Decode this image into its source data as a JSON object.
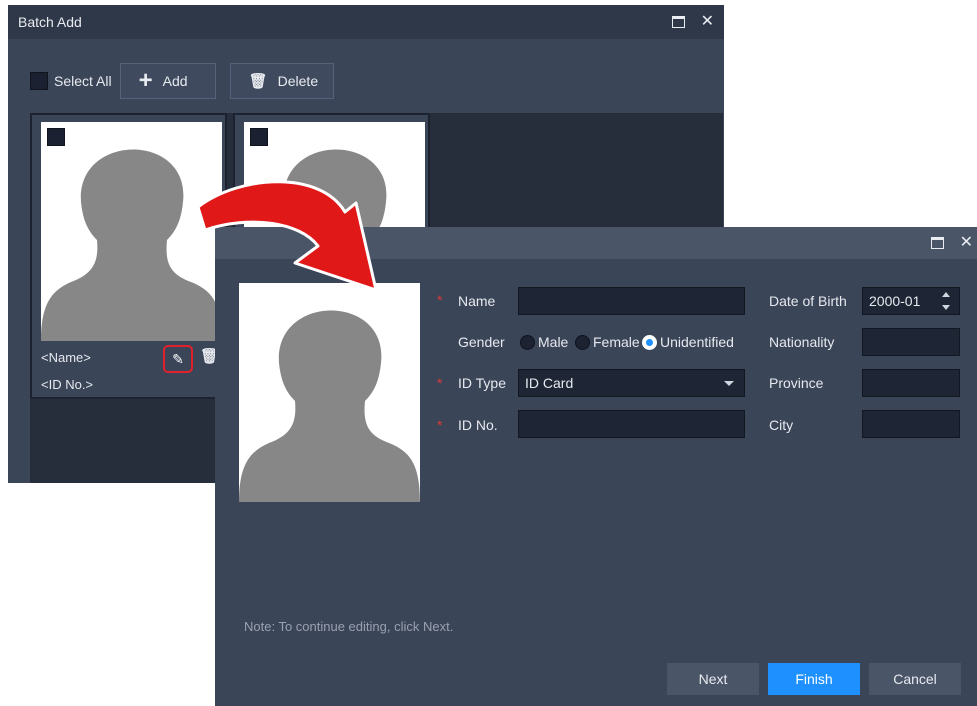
{
  "batch_window": {
    "title": "Batch Add",
    "select_all": "Select All",
    "add_label": "Add",
    "delete_label": "Delete",
    "cards": [
      {
        "name": "<Name>",
        "id_no": "<ID No.>"
      },
      {
        "name": "",
        "id_no": ""
      }
    ]
  },
  "edit_dialog": {
    "fields": {
      "name_label": "Name",
      "name_value": "",
      "gender_label": "Gender",
      "gender_options": [
        "Male",
        "Female",
        "Unidentified"
      ],
      "gender_selected": "Unidentified",
      "id_type_label": "ID Type",
      "id_type_value": "ID Card",
      "id_no_label": "ID No.",
      "id_no_value": "",
      "dob_label": "Date of Birth",
      "dob_value": "2000-01",
      "nationality_label": "Nationality",
      "province_label": "Province",
      "city_label": "City"
    },
    "note": "Note: To continue editing, click Next.",
    "buttons": {
      "next": "Next",
      "finish": "Finish",
      "cancel": "Cancel"
    }
  },
  "icons": {
    "window_maximize": "maximize-icon",
    "window_close": "close-icon",
    "add": "plus-icon",
    "delete": "trash-icon",
    "edit": "pencil-icon",
    "callout": "curved-arrow-icon"
  },
  "colors": {
    "primary_button": "#1e90ff",
    "required_marker": "#d93a3a",
    "highlight": "#e0202a",
    "window_bg": "#3b4558"
  }
}
